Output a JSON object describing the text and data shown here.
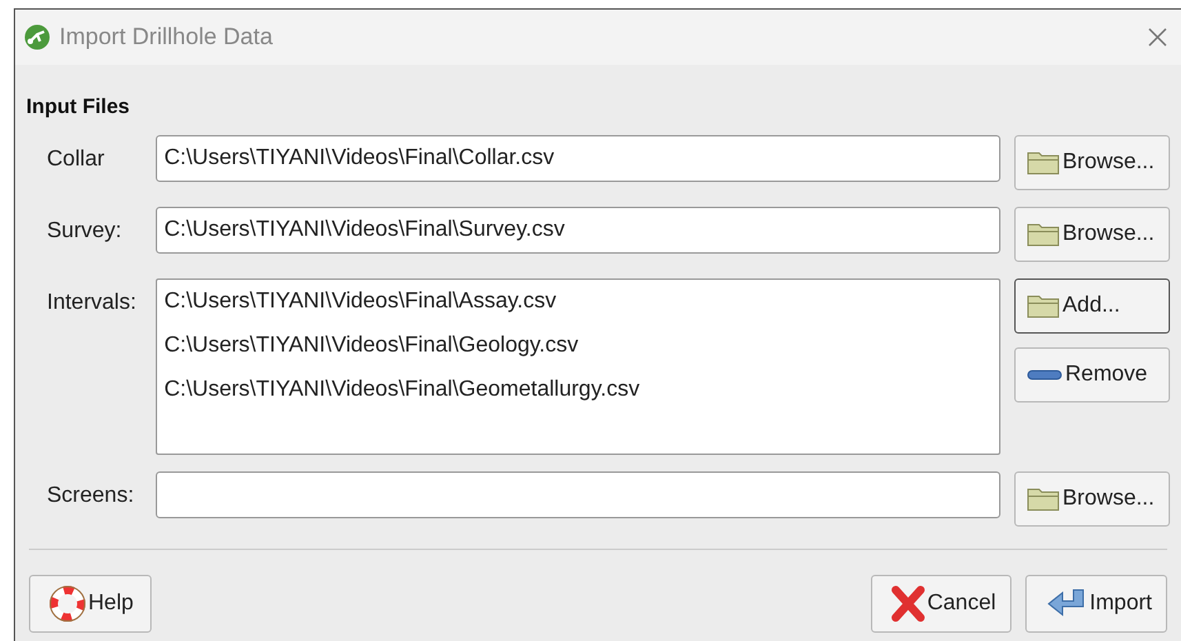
{
  "window": {
    "title": "Import Drillhole Data"
  },
  "section": {
    "title": "Input Files"
  },
  "rows": [
    {
      "kind": "field",
      "label": "Collar",
      "value": "C:\\Users\\TIYANI\\Videos\\Final\\Collar.csv",
      "buttons": [
        {
          "label": "Browse...",
          "kind": "folder",
          "focused": false
        }
      ]
    },
    {
      "kind": "field",
      "label": "Survey:",
      "value": "C:\\Users\\TIYANI\\Videos\\Final\\Survey.csv",
      "buttons": [
        {
          "label": "Browse...",
          "kind": "folder",
          "focused": false
        }
      ]
    },
    {
      "kind": "list",
      "label": "Intervals:",
      "items": [
        "C:\\Users\\TIYANI\\Videos\\Final\\Assay.csv",
        "C:\\Users\\TIYANI\\Videos\\Final\\Geology.csv",
        "C:\\Users\\TIYANI\\Videos\\Final\\Geometallurgy.csv"
      ],
      "buttons": [
        {
          "label": "Add...",
          "kind": "folder",
          "focused": true
        },
        {
          "label": "Remove",
          "kind": "minus",
          "focused": false
        }
      ]
    },
    {
      "kind": "field",
      "label": "Screens:",
      "value": "",
      "buttons": [
        {
          "label": "Browse...",
          "kind": "folder",
          "focused": false
        }
      ]
    }
  ],
  "footer": {
    "left": [
      {
        "label": "Help",
        "kind": "lifebuoy"
      }
    ],
    "right": [
      {
        "label": "Cancel",
        "kind": "cross"
      },
      {
        "label": "Import",
        "kind": "return"
      }
    ]
  }
}
